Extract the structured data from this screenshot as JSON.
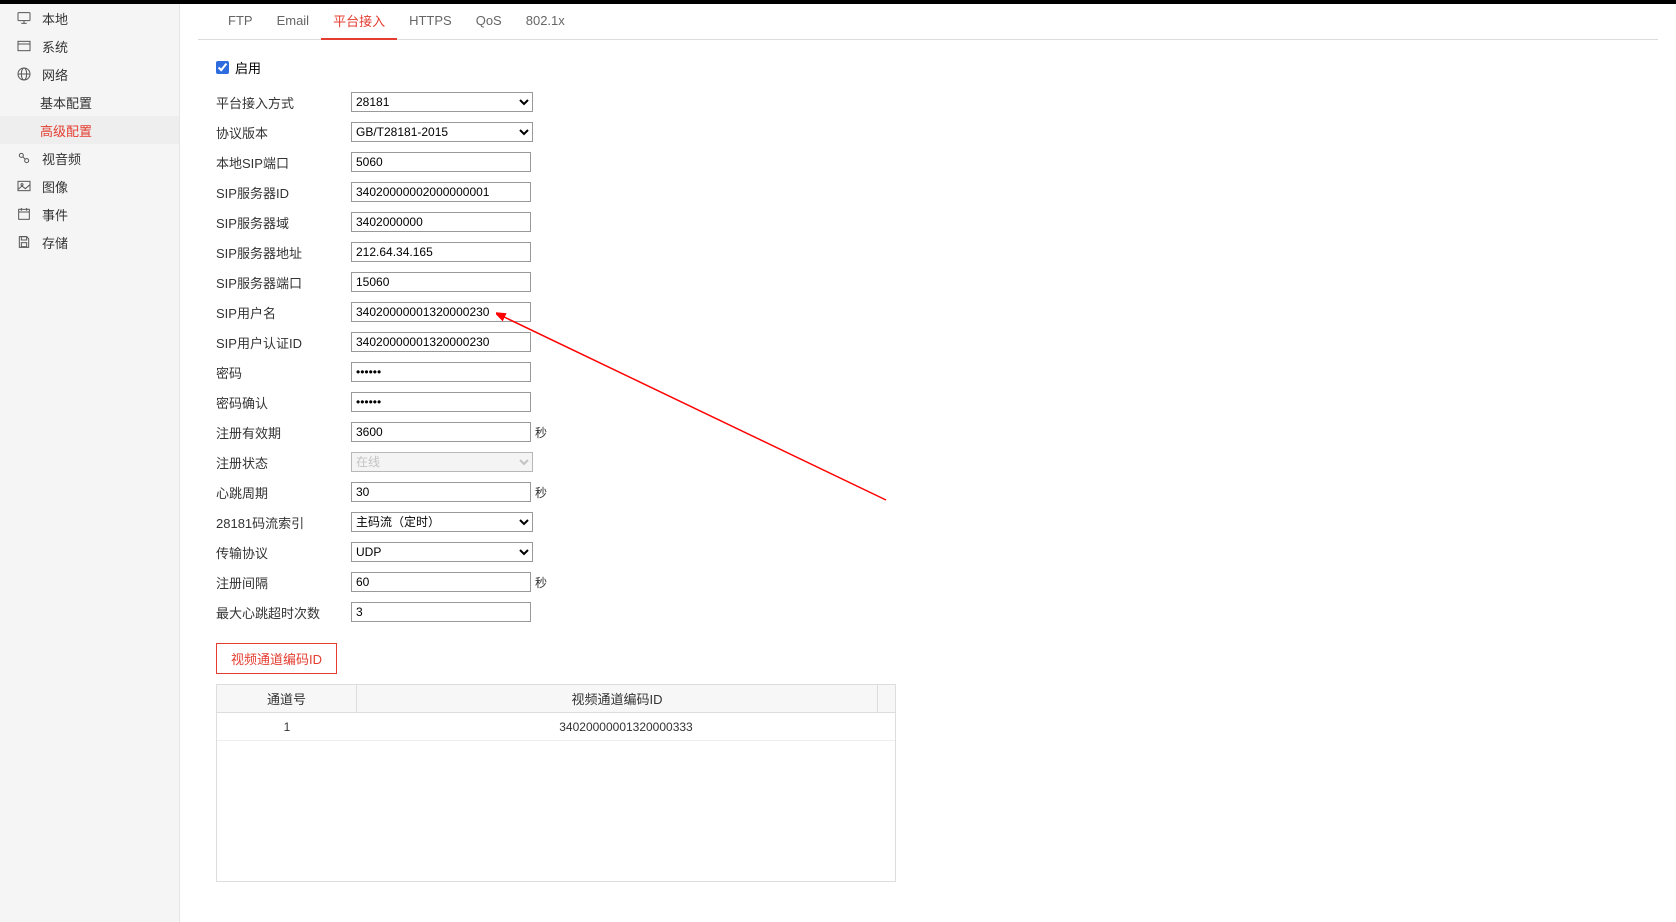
{
  "sidebar": {
    "items": [
      {
        "label": "本地",
        "icon": "monitor"
      },
      {
        "label": "系统",
        "icon": "window"
      },
      {
        "label": "网络",
        "icon": "globe"
      },
      {
        "label": "基本配置"
      },
      {
        "label": "高级配置"
      },
      {
        "label": "视音频",
        "icon": "av"
      },
      {
        "label": "图像",
        "icon": "image"
      },
      {
        "label": "事件",
        "icon": "calendar"
      },
      {
        "label": "存储",
        "icon": "save"
      }
    ]
  },
  "tabs": [
    "FTP",
    "Email",
    "平台接入",
    "HTTPS",
    "QoS",
    "802.1x"
  ],
  "active_tab": "平台接入",
  "form": {
    "enable_label": "启用",
    "enable_checked": true,
    "access_mode": {
      "label": "平台接入方式",
      "value": "28181"
    },
    "protocol_ver": {
      "label": "协议版本",
      "value": "GB/T28181-2015"
    },
    "local_sip_port": {
      "label": "本地SIP端口",
      "value": "5060"
    },
    "sip_server_id": {
      "label": "SIP服务器ID",
      "value": "34020000002000000001"
    },
    "sip_server_domain": {
      "label": "SIP服务器域",
      "value": "3402000000"
    },
    "sip_server_addr": {
      "label": "SIP服务器地址",
      "value": "212.64.34.165"
    },
    "sip_server_port": {
      "label": "SIP服务器端口",
      "value": "15060"
    },
    "sip_user": {
      "label": "SIP用户名",
      "value": "34020000001320000230"
    },
    "sip_auth_id": {
      "label": "SIP用户认证ID",
      "value": "34020000001320000230"
    },
    "password": {
      "label": "密码",
      "value": "••••••"
    },
    "password_confirm": {
      "label": "密码确认",
      "value": "••••••"
    },
    "reg_validity": {
      "label": "注册有效期",
      "value": "3600",
      "unit": "秒"
    },
    "reg_status": {
      "label": "注册状态",
      "value": "在线"
    },
    "heartbeat": {
      "label": "心跳周期",
      "value": "30",
      "unit": "秒"
    },
    "stream_index": {
      "label": "28181码流索引",
      "value": "主码流（定时）"
    },
    "transport": {
      "label": "传输协议",
      "value": "UDP"
    },
    "reg_interval": {
      "label": "注册间隔",
      "value": "60",
      "unit": "秒"
    },
    "max_hb_timeout": {
      "label": "最大心跳超时次数",
      "value": "3"
    }
  },
  "channel_btn": "视频通道编码ID",
  "table": {
    "header_channel": "通道号",
    "header_id": "视频通道编码ID",
    "rows": [
      {
        "ch": "1",
        "id": "34020000001320000333"
      }
    ]
  }
}
